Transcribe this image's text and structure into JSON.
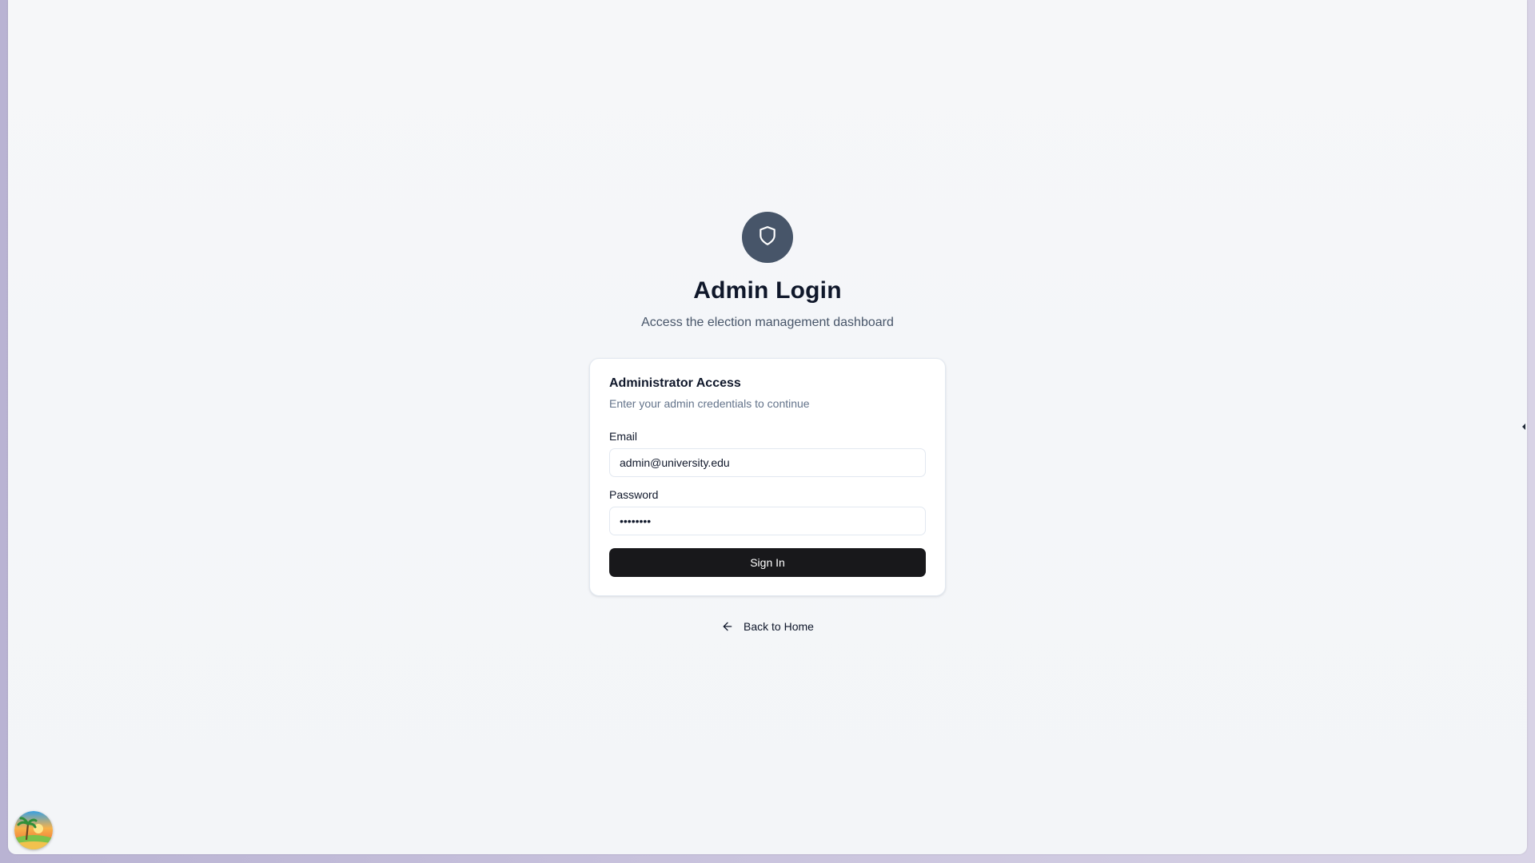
{
  "header": {
    "title": "Admin Login",
    "subtitle": "Access the election management dashboard",
    "logo_icon": "shield-icon"
  },
  "card": {
    "title": "Administrator Access",
    "description": "Enter your admin credentials to continue",
    "email": {
      "label": "Email",
      "value": "admin@university.edu"
    },
    "password": {
      "label": "Password",
      "value": "••••••••"
    },
    "submit_label": "Sign In"
  },
  "footer": {
    "back_label": "Back to Home",
    "back_icon": "arrow-left-icon"
  },
  "colors": {
    "logo_bg": "#475569",
    "primary_button": "#18181b",
    "page_bg": "#f5f7fa"
  },
  "widgets": {
    "avatar_icon": "beach-sunset-icon",
    "handle_icon": "caret-left-icon"
  }
}
